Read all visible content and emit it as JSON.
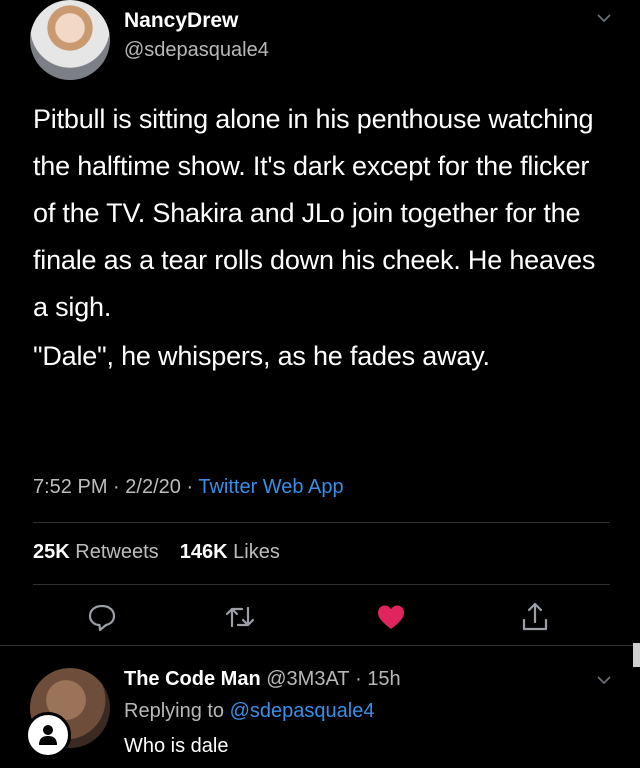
{
  "author": {
    "name": "NancyDrew",
    "handle": "@sdepasquale4"
  },
  "tweet": {
    "paragraphs": [
      "Pitbull is sitting alone in his penthouse watching the halftime show. It's dark except for the flicker of the TV. Shakira and JLo join together for the finale as a tear rolls down his cheek. He heaves a sigh.",
      "\"Dale\", he whispers, as he fades away."
    ],
    "time": "7:52 PM",
    "date": "2/2/20",
    "separator": "·",
    "source": "Twitter Web App"
  },
  "stats": {
    "retweets_count": "25K",
    "retweets_label": "Retweets",
    "likes_count": "146K",
    "likes_label": "Likes"
  },
  "actions": [
    {
      "icon": "reply-icon"
    },
    {
      "icon": "retweet-icon"
    },
    {
      "icon": "heart-icon",
      "color": "#e0245e"
    },
    {
      "icon": "share-icon"
    }
  ],
  "reply": {
    "name": "The Code Man",
    "handle": "@3M3AT",
    "separator": "·",
    "age": "15h",
    "replying_prefix": "Replying to",
    "replying_to": "@sdepasquale4",
    "text": "Who is dale"
  },
  "colors": {
    "background": "#000000",
    "link": "#3a8ee6",
    "like": "#e0245e"
  }
}
